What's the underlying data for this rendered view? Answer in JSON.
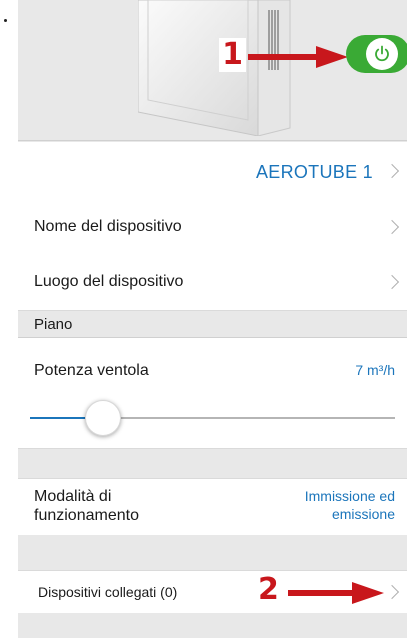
{
  "annotations": {
    "one": "1",
    "two": "2"
  },
  "device": {
    "name": "AEROTUBE 1",
    "power_on": true
  },
  "rows": {
    "nome": "Nome del dispositivo",
    "luogo": "Luogo del dispositivo",
    "piano": "Piano",
    "potenza_label": "Potenza ventola",
    "potenza_value": "7 m³/h",
    "modalita_label": "Modalità di funzionamento",
    "modalita_value": "Immissione ed emissione",
    "collegati": "Dispositivi collegati (0)"
  },
  "slider": {
    "level": 0.2
  },
  "colors": {
    "accent": "#1b75bb",
    "toggle_on": "#3aaa35",
    "annotation": "#c8171c"
  },
  "icons": {
    "power": "power-icon",
    "chevron": "chevron-right-icon",
    "arrow": "arrow-right-icon"
  }
}
